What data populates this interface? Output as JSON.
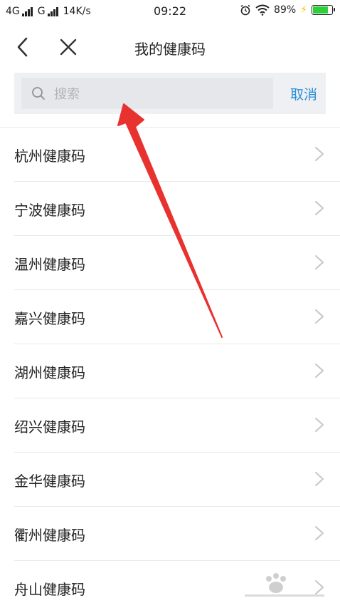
{
  "status_bar": {
    "net1": "4G",
    "net2": "G",
    "speed": "14K/s",
    "time": "09:22",
    "battery": "89%",
    "battery_level": 0.89
  },
  "nav": {
    "title": "我的健康码"
  },
  "search": {
    "placeholder": "搜索",
    "value": "",
    "cancel": "取消"
  },
  "list": {
    "items": [
      {
        "label": "杭州健康码"
      },
      {
        "label": "宁波健康码"
      },
      {
        "label": "温州健康码"
      },
      {
        "label": "嘉兴健康码"
      },
      {
        "label": "湖州健康码"
      },
      {
        "label": "绍兴健康码"
      },
      {
        "label": "金华健康码"
      },
      {
        "label": "衢州健康码"
      },
      {
        "label": "舟山健康码"
      }
    ]
  },
  "colors": {
    "accent": "#2b8fd6",
    "arrow": "#e8322f",
    "battery_fill": "#2fcf3a"
  }
}
